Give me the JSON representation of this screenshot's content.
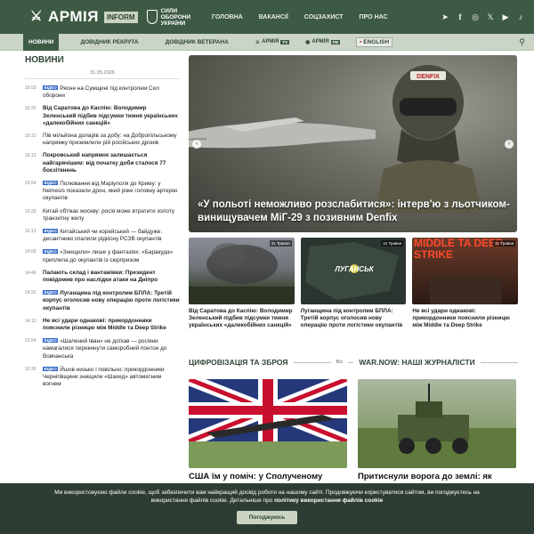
{
  "header": {
    "logo_text": "АРМІЯ",
    "logo_badge": "INFORM",
    "zsu_line1": "СИЛИ",
    "zsu_line2": "ОБОРОНИ",
    "zsu_line3": "УКРАЇНИ",
    "nav": [
      "ГОЛОВНА",
      "ВАКАНСІЇ",
      "СОЦЗАХИСТ",
      "ПРО НАС"
    ],
    "socials": [
      "telegram-icon",
      "facebook-icon",
      "instagram-icon",
      "x-icon",
      "youtube-icon",
      "tiktok-icon"
    ]
  },
  "subnav": {
    "items": [
      "НОВИНИ",
      "ДОВІДНИК РЕКРУТА",
      "ДОВІДНИК ВЕТЕРАНА"
    ],
    "tv1": "АРМІЯ",
    "tv1_badge": "TV",
    "tv2": "АРМІЯ",
    "tv2_badge": "FM",
    "lang": "ENGLISH"
  },
  "news": {
    "title": "НОВИНИ",
    "date": "31.05.2026",
    "items": [
      {
        "time": "16:53",
        "video": true,
        "bold": false,
        "text": "Рясне на Сумщині під контролем Сил оборони"
      },
      {
        "time": "16:32",
        "video": false,
        "bold": true,
        "text": "Від Саратова до Каспію: Володимир Зеленський підбив підсумки тижня українських «далекобійних санкцій»"
      },
      {
        "time": "16:31",
        "video": false,
        "bold": false,
        "text": "Пів мільйона доларів за добу: на Добропільському напрямку приземлили рій російських дронів"
      },
      {
        "time": "16:12",
        "video": false,
        "bold": true,
        "text": "Покровський напрямок залишається найгарячішим: від початку доби сталося 77 боєзіткнень"
      },
      {
        "time": "15:54",
        "video": true,
        "bold": false,
        "text": "Полювання від Маріуполя до Криму: у Nemesis показали дрон, який ріже головну артерію окупантів"
      },
      {
        "time": "15:29",
        "video": false,
        "bold": false,
        "text": "Китай обтікає москву: росія може втратити золоту транзитну жилу"
      },
      {
        "time": "15:13",
        "video": true,
        "bold": false,
        "text": "Китайський чи корейський — байдуже: десантники спалили рідкісну РСЗВ окупантів"
      },
      {
        "time": "14:59",
        "video": true,
        "bold": false,
        "text": "«Знищили» лише у фантазіях: «Баракуда» приплила до окупантів із сюрпризом"
      },
      {
        "time": "14:46",
        "video": false,
        "bold": true,
        "text": "Палають склад і вантажівки: Президент повідомив про наслідки атаки на Дніпро"
      },
      {
        "time": "14:22",
        "video": true,
        "bold": true,
        "text": "Луганщина під контролем БПЛА: Третій корпус оголосив нову операцію проти логістики окупантів"
      },
      {
        "time": "14:12",
        "video": false,
        "bold": true,
        "text": "Не всі удари однакові: прикордонники пояснили різницю між Middle та Deep Strike"
      },
      {
        "time": "13:54",
        "video": true,
        "bold": false,
        "text": "«Шалений Іван» не доїхав — росіяни намагалися перекинути саморобний понтон до Вовчанська"
      },
      {
        "time": "13:30",
        "video": true,
        "bold": false,
        "text": "Йшов низько і повільно: прикордонники Чернігівщини знищили «Шахед» автоматним вогнем"
      }
    ]
  },
  "hero": {
    "caption": "«У польоті неможливо розслабитися»: інтерв'ю з льотчиком-винищувачем МіГ-29 з позивним Denfix",
    "helmet_text": "DENFIX"
  },
  "cards": [
    {
      "date": "31 Травня",
      "caption": "Від Саратова до Каспію: Володимир Зеленський підбив підсумки тижня українських «далекобійних санкцій»"
    },
    {
      "date": "31 Травня",
      "caption": "Луганщина під контролем БПЛА: Третій корпус оголосив нову операцію проти логістики окупантів",
      "img_text": "ЛУГАНСЬК"
    },
    {
      "date": "31 Травня",
      "caption": "Не всі удари однакові: прикордонники пояснили різницю між Middle та Deep Strike",
      "img_text": "MIDDLE TA DEEP STRIKE"
    }
  ],
  "sections": {
    "left": "ЦИФРОВІЗАЦІЯ ТА ЗБРОЯ",
    "all": "Всі",
    "right": "WAR.NOW: НАШІ ЖУРНАЛІСТИ"
  },
  "big_cards": [
    {
      "caption": "США їм у поміч: у Сполученому"
    },
    {
      "caption": "Притиснули ворога до землі: як"
    }
  ],
  "cookie": {
    "line1": "Ми використовуємо файли cookie, щоб забезпечити вам найкращий досвід роботи на нашому сайті. Продовжуючи користуватися сайтом, ви погоджуєтесь на",
    "line2_pre": "використання файлів cookie. Детальніше про",
    "line2_link": "політику використання файлів cookie",
    "button": "Погоджуюсь"
  }
}
